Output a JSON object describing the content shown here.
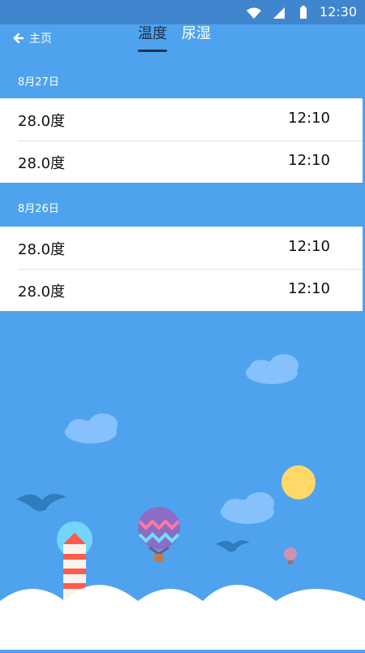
{
  "status_bar": {
    "time": "12:30",
    "icons": [
      "wifi-icon",
      "signal-icon",
      "battery-icon"
    ]
  },
  "nav": {
    "back_label": "主页",
    "tabs": [
      {
        "label": "温度",
        "active": true
      },
      {
        "label": "尿湿",
        "active": false
      }
    ]
  },
  "sections": [
    {
      "date": "8月27日",
      "records": [
        {
          "value": "28.0度",
          "time": "12:10"
        },
        {
          "value": "28.0度",
          "time": "12:10"
        }
      ]
    },
    {
      "date": "8月26日",
      "records": [
        {
          "value": "28.0度",
          "time": "12:10"
        },
        {
          "value": "28.0度",
          "time": "12:10"
        }
      ]
    }
  ],
  "colors": {
    "background": "#4fa3ee",
    "status_bar": "#3f86cf",
    "active_tab": "#1f2f4a",
    "sun": "#ffd86a"
  },
  "scene_elements": [
    "clouds",
    "birds",
    "hot-air-balloon",
    "lighthouse",
    "sun"
  ]
}
